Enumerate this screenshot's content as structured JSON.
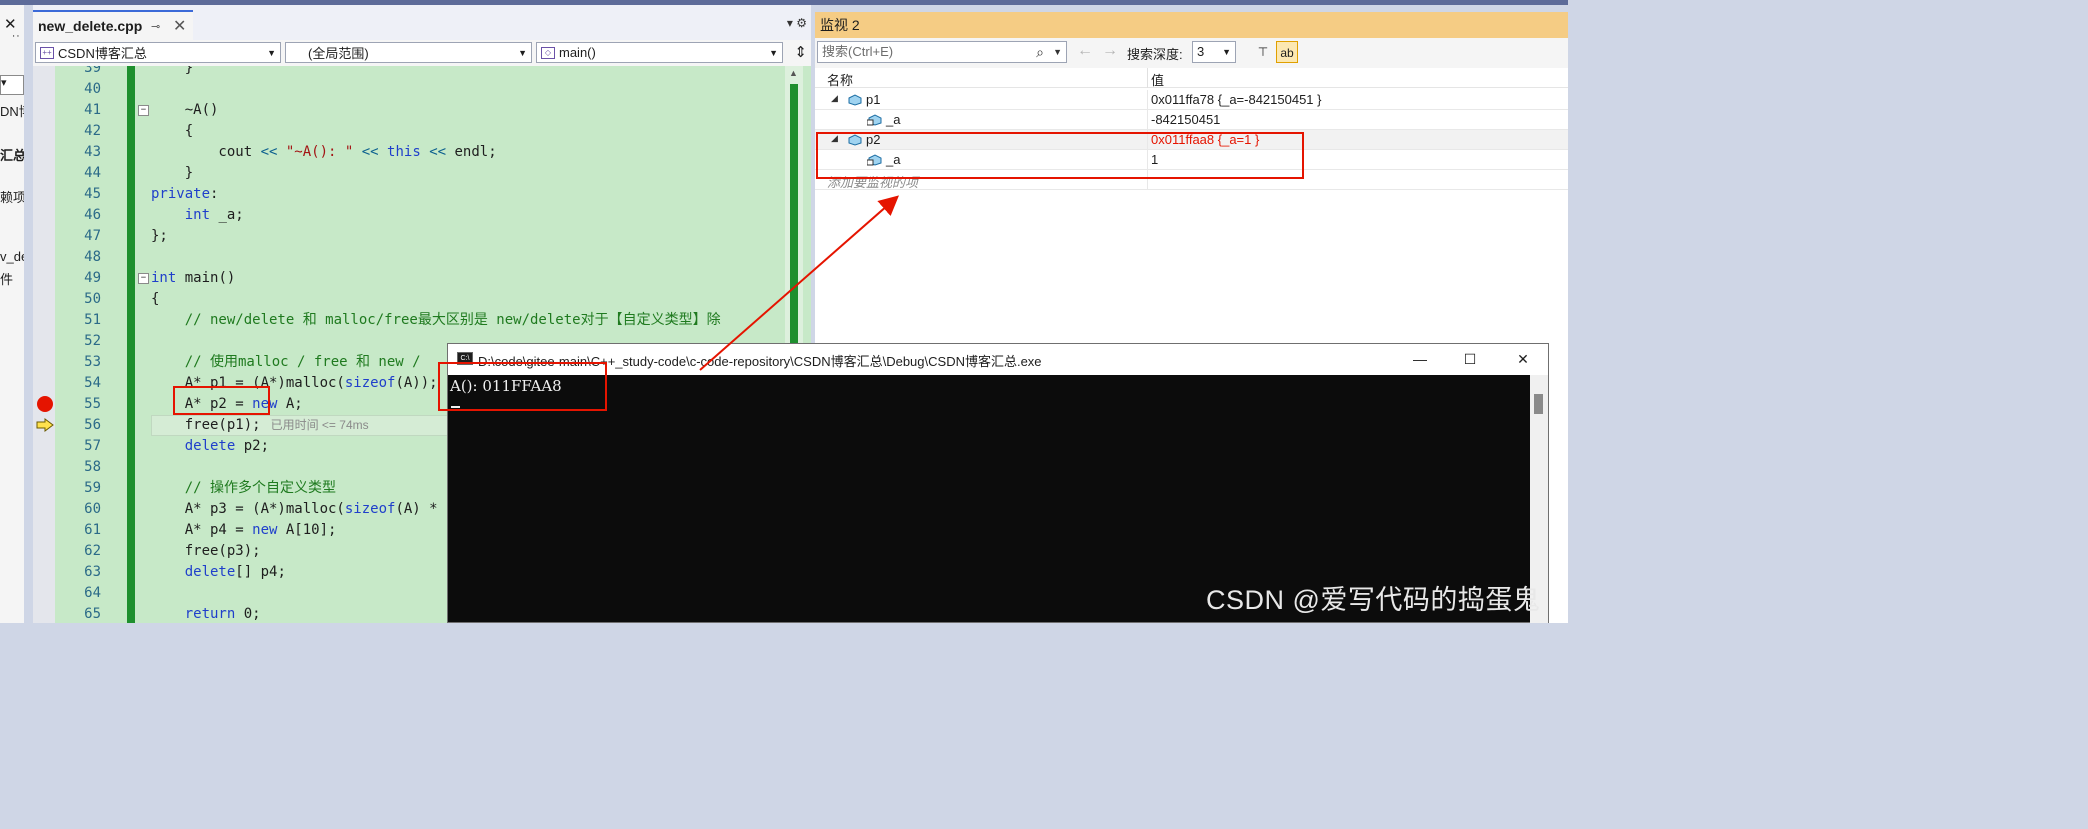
{
  "left_panel": {
    "close_glyph": "✕",
    "fragments": [
      "DN博",
      "汇总",
      "赖项",
      "v_de",
      "件"
    ]
  },
  "editor": {
    "tab": {
      "name": "new_delete.cpp",
      "pin_glyph": "⊸",
      "close_glyph": "✕"
    },
    "tab_tools": "▾  ⚙",
    "nav": {
      "project": "CSDN博客汇总",
      "scope": "(全局范围)",
      "function": "main()"
    },
    "lines": [
      {
        "n": "39",
        "code": "    }"
      },
      {
        "n": "40",
        "code": ""
      },
      {
        "n": "41",
        "code": "    ~A()"
      },
      {
        "n": "42",
        "code": "    {"
      },
      {
        "n": "43",
        "code": "        cout << \"~A(): \" << this << endl;"
      },
      {
        "n": "44",
        "code": "    }"
      },
      {
        "n": "45",
        "code": "private:"
      },
      {
        "n": "46",
        "code": "    int _a;"
      },
      {
        "n": "47",
        "code": "};"
      },
      {
        "n": "48",
        "code": ""
      },
      {
        "n": "49",
        "code": "int main()"
      },
      {
        "n": "50",
        "code": "{"
      },
      {
        "n": "51",
        "code": "    // new/delete 和 malloc/free最大区别是 new/delete对于【自定义类型】除"
      },
      {
        "n": "52",
        "code": ""
      },
      {
        "n": "53",
        "code": "    // 使用malloc / free 和 new /"
      },
      {
        "n": "54",
        "code": "    A* p1 = (A*)malloc(sizeof(A));"
      },
      {
        "n": "55",
        "code": "    A* p2 = new A;"
      },
      {
        "n": "56",
        "code": "    free(p1);",
        "hint": "已用时间 <= 74ms"
      },
      {
        "n": "57",
        "code": "    delete p2;"
      },
      {
        "n": "58",
        "code": ""
      },
      {
        "n": "59",
        "code": "    // 操作多个自定义类型"
      },
      {
        "n": "60",
        "code": "    A* p3 = (A*)malloc(sizeof(A) *"
      },
      {
        "n": "61",
        "code": "    A* p4 = new A[10];"
      },
      {
        "n": "62",
        "code": "    free(p3);"
      },
      {
        "n": "63",
        "code": "    delete[] p4;"
      },
      {
        "n": "64",
        "code": ""
      },
      {
        "n": "65",
        "code": "    return 0;"
      }
    ]
  },
  "watch": {
    "title": "监视 2",
    "search_placeholder": "搜索(Ctrl+E)",
    "depth_label": "搜索深度:",
    "depth_value": "3",
    "col_name": "名称",
    "col_value": "值",
    "rows": [
      {
        "name": "p1",
        "value": "0x011ffa78 {_a=-842150451 }",
        "changed": false,
        "level": 0
      },
      {
        "name": "_a",
        "value": "-842150451",
        "changed": false,
        "level": 1
      },
      {
        "name": "p2",
        "value": "0x011ffaa8 {_a=1 }",
        "changed": true,
        "level": 0
      },
      {
        "name": "_a",
        "value": "1",
        "changed": false,
        "level": 1
      }
    ],
    "add_watch": "添加要监视的项"
  },
  "console": {
    "icon_text": "C:\\",
    "title": "D:\\code\\gitee-main\\C++_study-code\\c-code-repository\\CSDN博客汇总\\Debug\\CSDN博客汇总.exe",
    "output": "A(): 011FFAA8"
  },
  "watermark": "CSDN @爱写代码的捣蛋鬼",
  "colors": {
    "annotation_red": "#e51400",
    "editor_green": "#c7e9c8",
    "watch_title_bg": "#f5cc84"
  }
}
